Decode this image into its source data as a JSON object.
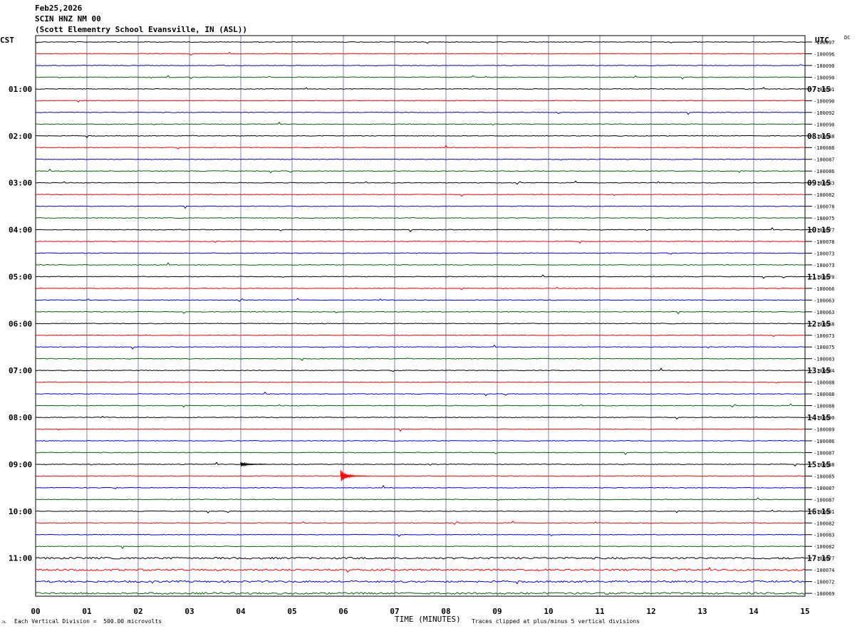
{
  "header": {
    "date": "Feb25,2026",
    "station": "SCIN HNZ NM 00",
    "location": "(Scott Elementry School Evansville, IN (ASL))"
  },
  "left_tz": "CST",
  "right_tz": "UTC",
  "dc_label": "DC",
  "footer": {
    "scale": "Each Vertical Division =  500.00 microvolts",
    "xlabel": "TIME (MINUTES)",
    "clip_note": "Traces clipped at plus/minus 5 vertical divisions"
  },
  "colors": {
    "black": "#000000",
    "red": "#ff0000",
    "blue": "#0000ff",
    "green": "#006400",
    "grid": "#8080b0"
  },
  "chart_data": {
    "type": "line",
    "title": "SCIN HNZ NM 00",
    "xlabel": "TIME (MINUTES)",
    "xlim": [
      0,
      15
    ],
    "x_ticks": [
      "00",
      "01",
      "02",
      "03",
      "04",
      "05",
      "06",
      "07",
      "08",
      "09",
      "10",
      "11",
      "12",
      "13",
      "14",
      "15"
    ],
    "trace_minutes": 15,
    "trace_count": 48,
    "trace_colors": [
      "black",
      "red",
      "blue",
      "green"
    ],
    "left_hour_labels": [
      "01:00",
      "02:00",
      "03:00",
      "04:00",
      "05:00",
      "06:00",
      "07:00",
      "08:00",
      "09:00",
      "10:00",
      "11:00"
    ],
    "right_hour_labels": [
      "07:15",
      "08:15",
      "09:15",
      "10:15",
      "11:15",
      "12:15",
      "13:15",
      "14:15",
      "15:15",
      "16:15",
      "17:15"
    ],
    "dc_offsets": [
      "-100097",
      "-100096",
      "-100090",
      "-100090",
      "-100091",
      "-100090",
      "-100092",
      "-100090",
      "-100088",
      "-100086",
      "-100087",
      "-100086",
      "-100083",
      "-100082",
      "-100078",
      "-100075",
      "-100077",
      "-100078",
      "-100073",
      "-100073",
      "-100070",
      "-100066",
      "-100063",
      "-100063",
      "-100068",
      "-100073",
      "-100075",
      "-100083",
      "-100084",
      "-100088",
      "-100088",
      "-100088",
      "-100090",
      "-100089",
      "-100086",
      "-100087",
      "-100088",
      "-100085",
      "-100087",
      "-100087",
      "-100081",
      "-100082",
      "-100083",
      "-100082",
      "-100077",
      "-100074",
      "-100072",
      "-100069"
    ],
    "events": [
      {
        "trace": 36,
        "minute": 4.0,
        "amplitude": 3,
        "description": "small red burst"
      },
      {
        "trace": 37,
        "minute": 5.95,
        "amplitude": 8,
        "description": "local event on blue trace"
      }
    ]
  }
}
